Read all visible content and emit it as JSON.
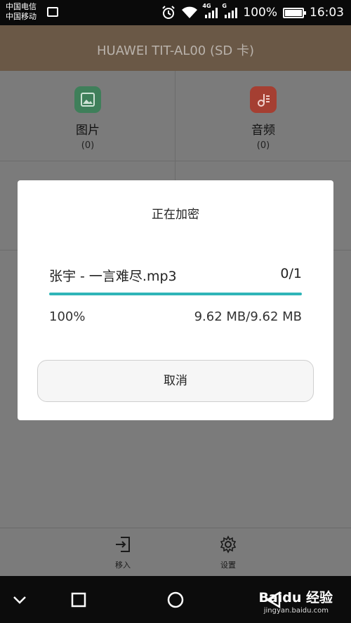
{
  "status_bar": {
    "carrier1": "中国电信",
    "carrier2": "中国移动",
    "battery": "100%",
    "time": "16:03",
    "net1": "4G",
    "net2": "G"
  },
  "header": {
    "title": "HUAWEI TIT-AL00 (SD 卡)"
  },
  "categories": [
    {
      "label": "图片",
      "count": "(0)",
      "icon": "picture-icon",
      "color": "#4a9d6e"
    },
    {
      "label": "音频",
      "count": "(0)",
      "icon": "music-icon",
      "color": "#c94a3a"
    }
  ],
  "dialog": {
    "title": "正在加密",
    "file_name": "张宇 - 一言难尽.mp3",
    "file_count": "0/1",
    "percent": "100%",
    "progress": 1.0,
    "size": "9.62 MB/9.62 MB",
    "cancel_label": "取消",
    "accent": "#2fb5b8"
  },
  "bottom_actions": [
    {
      "label": "移入",
      "icon": "move-in-icon"
    },
    {
      "label": "设置",
      "icon": "gear-icon"
    }
  ],
  "watermark": {
    "brand": "Baidu 经验",
    "url": "jingyan.baidu.com"
  }
}
